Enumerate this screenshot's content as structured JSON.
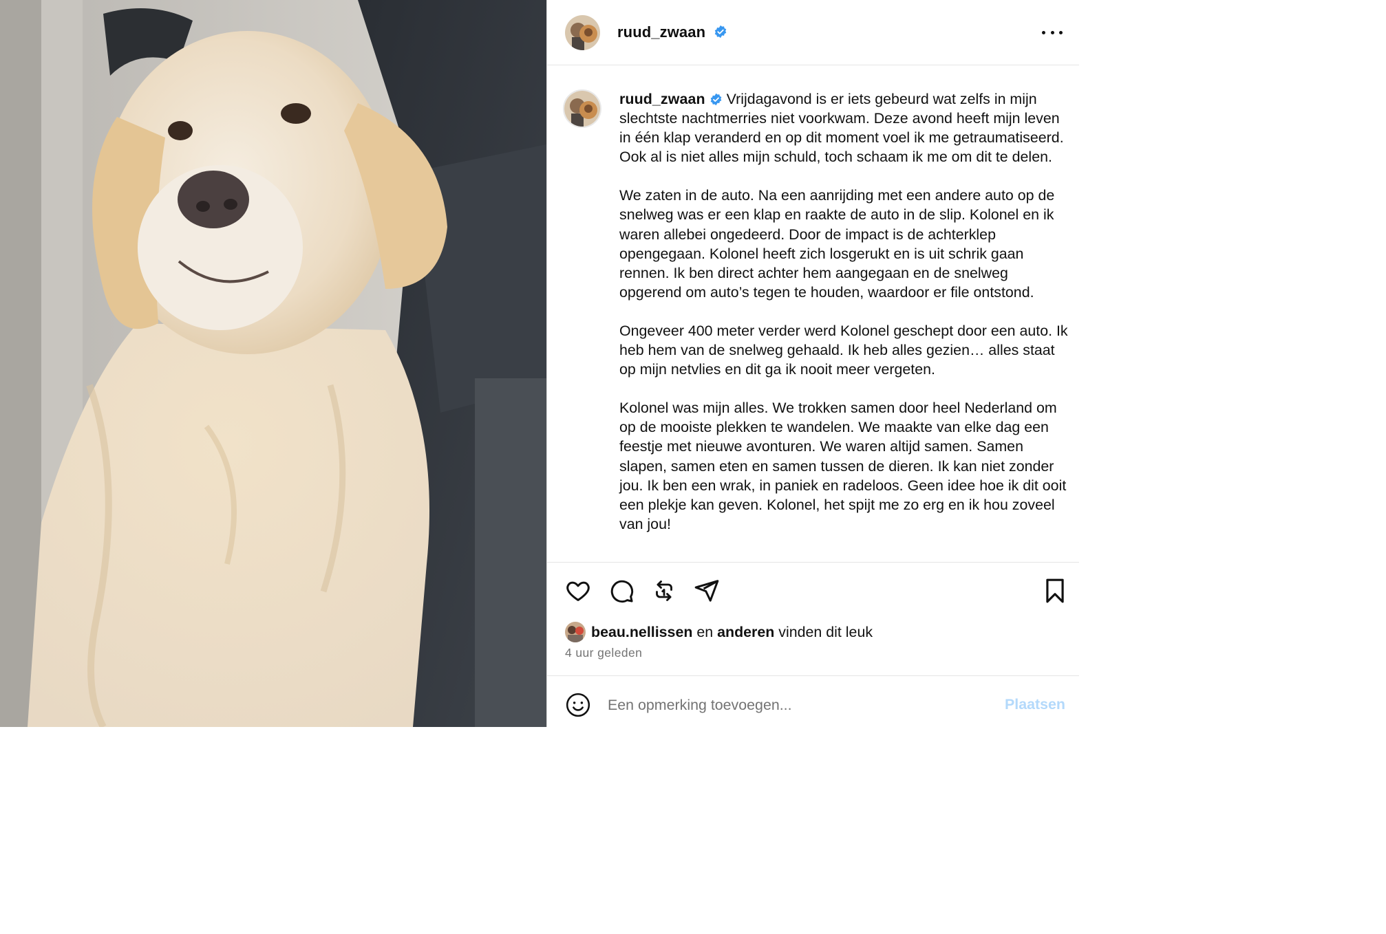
{
  "post": {
    "username": "ruud_zwaan",
    "caption_paragraphs": [
      "Vrijdagavond is er iets gebeurd wat zelfs in mijn slechtste nachtmerries niet voorkwam. Deze avond heeft mijn leven in één klap veranderd en op dit moment voel ik me getraumatiseerd. Ook al is niet alles mijn schuld, toch schaam ik me om dit te delen.",
      "We zaten in de auto. Na een aanrijding met een andere auto op de snelweg was er een klap en raakte de auto in de slip. Kolonel en ik waren allebei ongedeerd. Door de impact is de achterklep opengegaan. Kolonel heeft zich losgerukt en is uit schrik gaan rennen. Ik ben direct achter hem aangegaan en de snelweg opgerend om auto’s tegen te houden, waardoor er file ontstond.",
      "Ongeveer 400 meter verder werd Kolonel geschept door een auto. Ik heb hem van de snelweg gehaald. Ik heb alles gezien… alles staat op mijn netvlies en dit ga ik nooit meer vergeten.",
      "Kolonel was mijn alles. We trokken samen door heel Nederland om op de mooiste plekken te wandelen. We maakte van elke dag een feestje met nieuwe avonturen. We waren altijd samen. Samen slapen, samen eten en samen tussen de dieren. Ik kan niet zonder jou. Ik ben een wrak, in paniek en radeloos. Geen idee hoe ik dit ooit een plekje kan geven. Kolonel, het spijt me zo erg en ik hou zoveel van jou!"
    ],
    "likes": {
      "user": "beau.nellissen",
      "conj": "en",
      "others": "anderen",
      "suffix": "vinden dit leuk"
    },
    "time_ago": "4 uur geleden"
  },
  "comment": {
    "placeholder": "Een opmerking toevoegen...",
    "post_label": "Plaatsen"
  },
  "icons": {
    "verified": "verified-badge-icon",
    "more": "more-options-icon",
    "like": "heart-icon",
    "comment": "comment-bubble-icon",
    "repost": "repost-icon",
    "share": "send-paper-plane-icon",
    "save": "bookmark-icon",
    "emoji": "emoji-smiley-icon"
  },
  "colors": {
    "verified": "#3897f0",
    "post_button_disabled": "#b3d9fb",
    "secondary_text": "#737373"
  }
}
